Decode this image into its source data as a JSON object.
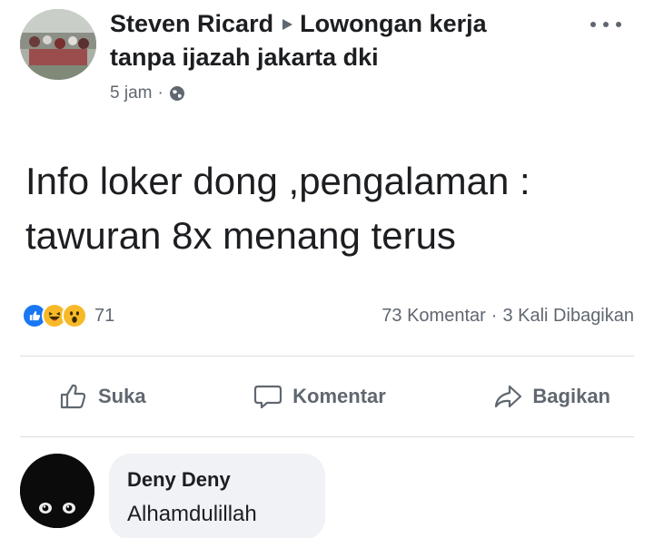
{
  "post": {
    "author": "Steven Ricard",
    "group_line1": "Lowongan kerja",
    "group_line2": "tanpa ijazah jakarta dki",
    "time": "5 jam",
    "privacy_icon": "globe-icon",
    "more_icon": "more-options-icon",
    "text_line1": "Info loker dong ,pengalaman :",
    "text_line2": "tawuran 8x menang terus"
  },
  "reactions": {
    "icons": [
      "like-reaction-icon",
      "haha-reaction-icon",
      "wow-reaction-icon"
    ],
    "count": "71",
    "comments": "73 Komentar",
    "shares": "3 Kali Dibagikan"
  },
  "actions": {
    "like": "Suka",
    "comment": "Komentar",
    "share": "Bagikan"
  },
  "comment": {
    "author": "Deny Deny",
    "text": "Alhamdulillah"
  },
  "colors": {
    "text": "#1c1e21",
    "secondary": "#606770",
    "bubble": "#f0f2f5",
    "like_blue": "#1877f2",
    "reaction_yellow": "#f7b928"
  }
}
